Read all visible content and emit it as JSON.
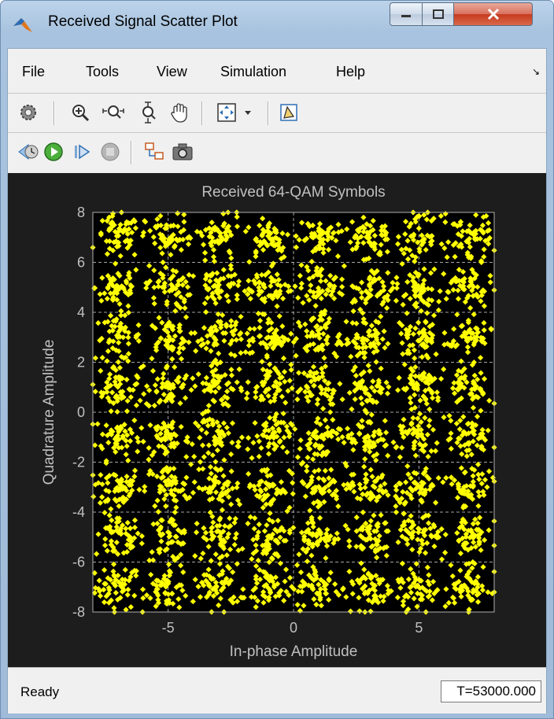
{
  "window": {
    "title": "Received Signal Scatter Plot"
  },
  "menu": {
    "items": [
      "File",
      "Tools",
      "View",
      "Simulation",
      "Help"
    ]
  },
  "toolbar1": {
    "icons": [
      "gear-icon",
      "zoom-in-icon",
      "zoom-x-icon",
      "zoom-y-icon",
      "pan-hand-icon",
      "autoscale-icon",
      "dropdown-arrow-icon",
      "highlight-block-icon"
    ]
  },
  "toolbar2": {
    "icons": [
      "step-back-icon",
      "run-icon",
      "step-forward-icon",
      "stop-icon",
      "simulink-block-icon",
      "camera-icon"
    ]
  },
  "status": {
    "left": "Ready",
    "right": "T=53000.000"
  },
  "colors": {
    "marker": "#ffff00",
    "plot_bg": "#000000",
    "figure_bg": "#1d1d1d",
    "text": "#c0c0c0",
    "grid": "#cfcfcf"
  },
  "chart_data": {
    "type": "scatter",
    "title": "Received 64-QAM Symbols",
    "xlabel": "In-phase Amplitude",
    "ylabel": "Quadrature Amplitude",
    "xlim": [
      -8,
      8
    ],
    "ylim": [
      -8,
      8
    ],
    "xticks": [
      "-5",
      "0",
      "5"
    ],
    "yticks": [
      "8",
      "6",
      "4",
      "2",
      "0",
      "-2",
      "-4",
      "-6",
      "-8"
    ],
    "grid": true,
    "marker": "diamond",
    "cluster_centers_I": [
      -7,
      -5,
      -3,
      -1,
      1,
      3,
      5,
      7
    ],
    "cluster_centers_Q": [
      -7,
      -5,
      -3,
      -1,
      1,
      3,
      5,
      7
    ],
    "approx_noise_std": 0.45,
    "outliers": [
      [
        -2.8,
        7.95
      ],
      [
        -7.9,
        -2.9
      ],
      [
        7.0,
        -7.9
      ],
      [
        -1.5,
        -7.8
      ]
    ]
  }
}
